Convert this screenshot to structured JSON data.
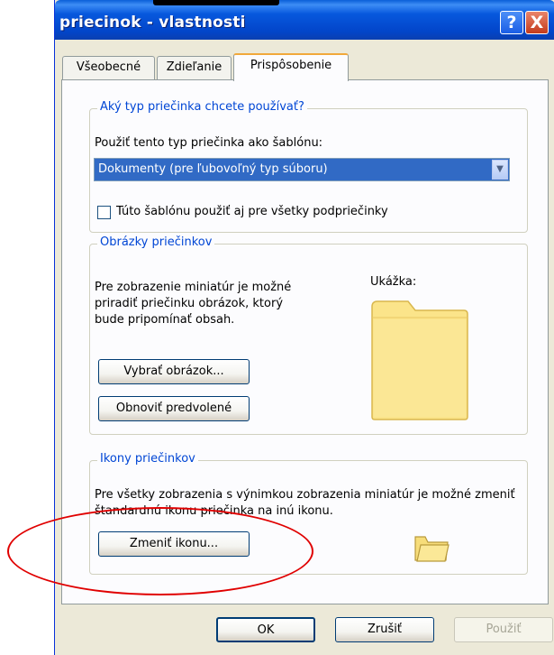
{
  "window": {
    "title": "priecinok - vlastnosti"
  },
  "title_buttons": {
    "help": "?",
    "close": "X"
  },
  "tabs": [
    {
      "label": "Všeobecné"
    },
    {
      "label": "Zdieľanie"
    },
    {
      "label": "Prispôsobenie"
    }
  ],
  "folder_type": {
    "legend": "Aký typ priečinka chcete používať?",
    "template_label": "Použiť tento typ priečinka ako šablónu:",
    "template_value": "Dokumenty (pre ľubovoľný typ súboru)",
    "subfolders_checkbox_label": "Túto šablónu použiť aj pre všetky podpriečinky",
    "subfolders_checked": false
  },
  "folder_pictures": {
    "legend": "Obrázky priečinkov",
    "description": "Pre zobrazenie miniatúr je možné priradiť priečinku obrázok, ktorý bude pripomínať obsah.",
    "preview_label": "Ukážka:",
    "choose_button": "Vybrať obrázok...",
    "restore_button": "Obnoviť predvolené"
  },
  "folder_icons": {
    "legend": "Ikony priečinkov",
    "description": "Pre všetky zobrazenia s výnimkou zobrazenia miniatúr je možné zmeniť štandardnú ikonu priečinka na inú ikonu.",
    "change_button": "Zmeniť ikonu..."
  },
  "footer": {
    "ok": "OK",
    "cancel": "Zrušiť",
    "apply": "Použiť"
  },
  "icons": [
    "help-icon",
    "close-icon",
    "chevron-down-icon",
    "folder-preview-icon",
    "folder-icon"
  ],
  "colors": {
    "titlebar": "#0245c9",
    "selection": "#316ac5",
    "legend": "#0046d5",
    "annotation": "#e00000"
  }
}
